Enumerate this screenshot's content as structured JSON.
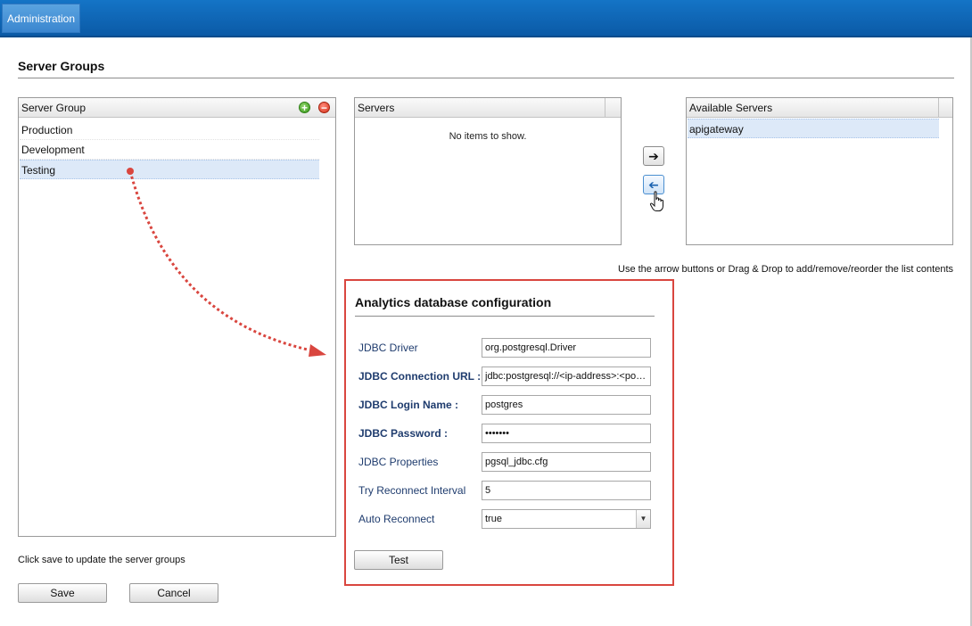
{
  "header": {
    "tab_label": "Administration"
  },
  "page": {
    "title": "Server Groups"
  },
  "server_groups": {
    "header": "Server Group",
    "items": [
      "Production",
      "Development",
      "Testing"
    ],
    "selected": "Testing"
  },
  "servers": {
    "header": "Servers",
    "empty_text": "No items to show."
  },
  "available_servers": {
    "header": "Available Servers",
    "items": [
      "apigateway"
    ]
  },
  "hint_text": "Use the arrow buttons or Drag & Drop to add/remove/reorder the list contents",
  "analytics": {
    "title": "Analytics database configuration",
    "fields": [
      {
        "label": "JDBC Driver",
        "value": "org.postgresql.Driver"
      },
      {
        "label": "JDBC Connection URL :",
        "value": "jdbc:postgresql://<ip-address>:<port>"
      },
      {
        "label": "JDBC Login Name :",
        "value": "postgres"
      },
      {
        "label": "JDBC Password :",
        "value": "•••••••"
      },
      {
        "label": "JDBC Properties",
        "value": "pgsql_jdbc.cfg"
      },
      {
        "label": "Try Reconnect Interval",
        "value": "5"
      },
      {
        "label": "Auto Reconnect",
        "value": "true"
      }
    ],
    "test_label": "Test"
  },
  "footer": {
    "save_hint": "Click save to update the server groups",
    "save_label": "Save",
    "cancel_label": "Cancel"
  },
  "colors": {
    "topbar": "#0b5aa6",
    "highlight_border": "#d9463f",
    "selected_row": "#dde9f8"
  }
}
